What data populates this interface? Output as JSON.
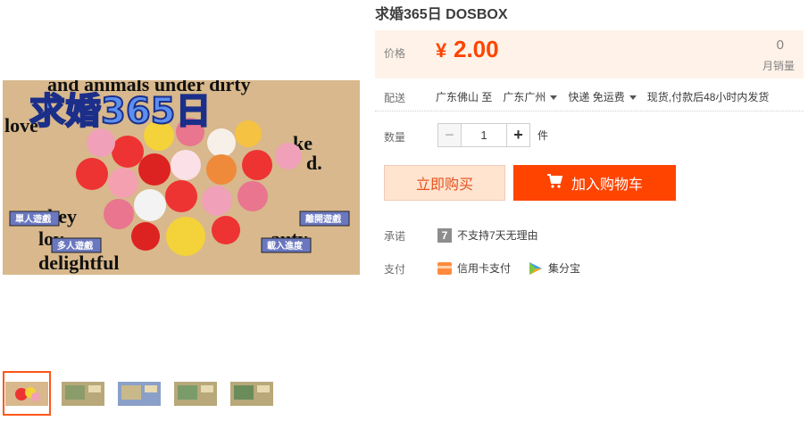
{
  "product": {
    "title": "求婚365日 DOSBOX",
    "price_label": "价格",
    "currency": "¥",
    "price": "2.00",
    "sales_count": "0",
    "sales_label": "月销量"
  },
  "shipping": {
    "label": "配送",
    "from": "广东佛山",
    "to_word": "至",
    "to": "广东广州",
    "method": "快递 免运费",
    "note": "现货,付款后48小时内发货"
  },
  "quantity": {
    "label": "数量",
    "minus": "−",
    "value": "1",
    "plus": "+",
    "unit": "件"
  },
  "actions": {
    "buy_now": "立即购买",
    "add_to_cart": "加入购物车"
  },
  "promise": {
    "label": "承诺",
    "badge": "7",
    "text": "不支持7天无理由"
  },
  "payment": {
    "label": "支付",
    "methods": [
      "信用卡支付",
      "集分宝"
    ]
  },
  "image": {
    "logo_text": "求婚365日",
    "menu": [
      "單人遊戲",
      "離開遊戲",
      "多人遊戲",
      "載入進度"
    ]
  },
  "colors": {
    "accent": "#ff4400",
    "price_bg": "#fff2e8",
    "thumb_active": "#ff5719"
  }
}
